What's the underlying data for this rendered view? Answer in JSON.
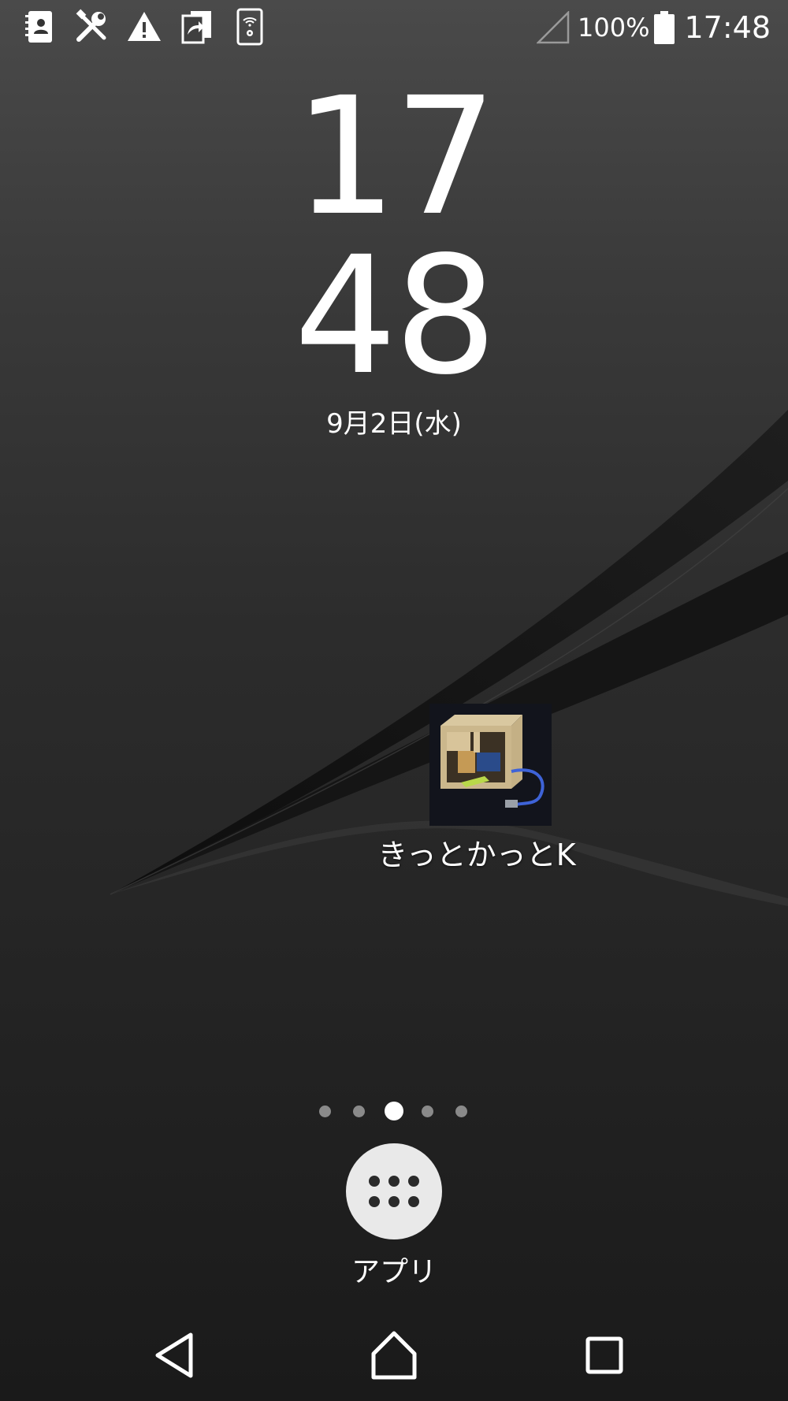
{
  "status_bar": {
    "left_icons": [
      "contacts-book-icon",
      "tools-icon",
      "warning-icon",
      "share-card-icon",
      "wifi-settings-icon"
    ],
    "signal_icon": "signal-empty-icon",
    "battery_percent": "100%",
    "battery_icon": "battery-full-icon",
    "time": "17:48"
  },
  "clock": {
    "hours": "17",
    "minutes": "48",
    "date": "9月2日(水)"
  },
  "home_shortcut": {
    "label": "きっとかっとK",
    "icon": "project-photo-thumbnail"
  },
  "page_indicator": {
    "total": 5,
    "active_index": 2
  },
  "app_drawer": {
    "label": "アプリ",
    "icon": "grid-dots-icon"
  },
  "nav_bar": {
    "back_icon": "back-icon",
    "home_icon": "home-icon",
    "recents_icon": "recents-icon"
  },
  "colors": {
    "text": "#ffffff",
    "dot_inactive": "#8a8a8a",
    "drawer_button": "#e9e9e9"
  }
}
